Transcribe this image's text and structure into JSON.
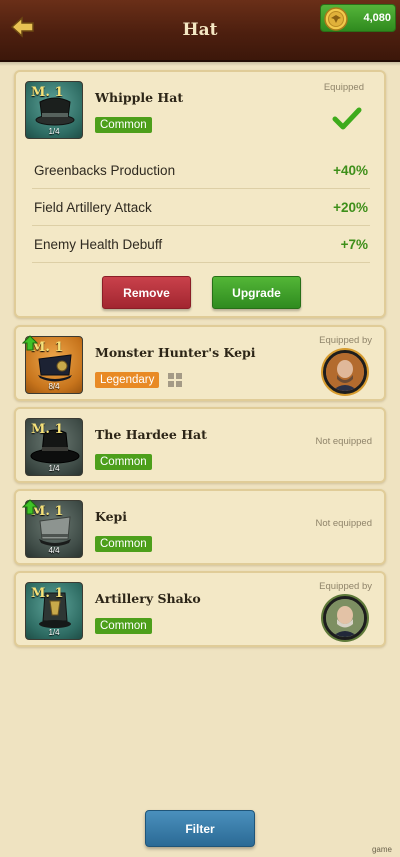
{
  "header": {
    "title": "Hat",
    "currency": "4,080",
    "back_icon": "back-arrow-icon",
    "coin_icon": "eagle-coin-icon"
  },
  "equipped_item": {
    "level": "M. 1",
    "count": "1/4",
    "name": "Whipple Hat",
    "rarity": "Common",
    "status": "Equipped",
    "status_icon": "checkmark-icon",
    "stats": [
      {
        "label": "Greenbacks Production",
        "value": "+40%"
      },
      {
        "label": "Field Artillery Attack",
        "value": "+20%"
      },
      {
        "label": "Enemy Health Debuff",
        "value": "+7%"
      }
    ],
    "remove_label": "Remove",
    "upgrade_label": "Upgrade"
  },
  "items": [
    {
      "level": "M. 1",
      "count": "8/4",
      "name": "Monster Hunter's Kepi",
      "rarity": "Legendary",
      "status": "Equipped by",
      "upgradable": true
    },
    {
      "level": "M. 1",
      "count": "1/4",
      "name": "The Hardee Hat",
      "rarity": "Common",
      "status": "Not equipped",
      "upgradable": false
    },
    {
      "level": "M. 1",
      "count": "4/4",
      "name": "Kepi",
      "rarity": "Common",
      "status": "Not equipped",
      "upgradable": true
    },
    {
      "level": "M. 1",
      "count": "1/4",
      "name": "Artillery Shako",
      "rarity": "Common",
      "status": "Equipped by",
      "upgradable": false
    }
  ],
  "footer": {
    "filter_label": "Filter",
    "watermark": "game"
  },
  "colors": {
    "background": "#efe3c1",
    "header": "#4d1f0f",
    "common": "#4d9f1b",
    "legendary": "#e88a25",
    "stat_value": "#3e8f1a",
    "remove": "#b3303a",
    "upgrade": "#3fa02a",
    "filter": "#3a7faa"
  }
}
